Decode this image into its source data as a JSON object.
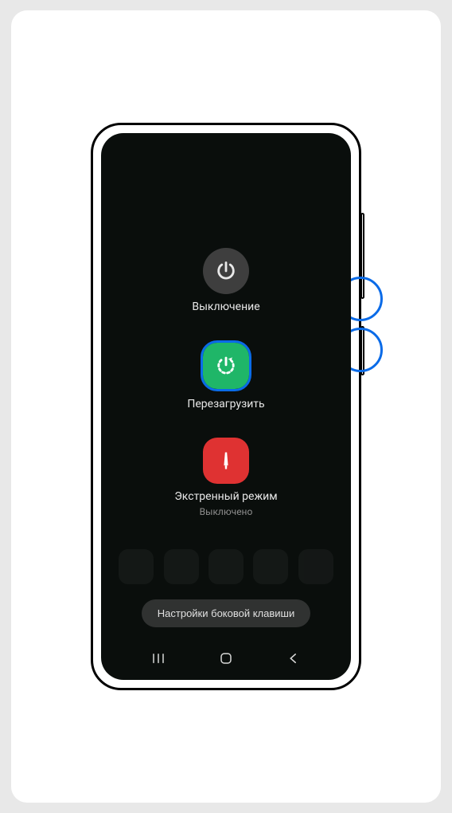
{
  "powerMenu": {
    "powerOff": {
      "label": "Выключение"
    },
    "restart": {
      "label": "Перезагрузить"
    },
    "emergency": {
      "label": "Экстренный режим",
      "sublabel": "Выключено"
    },
    "sideKeySettings": "Настройки боковой клавиши"
  }
}
